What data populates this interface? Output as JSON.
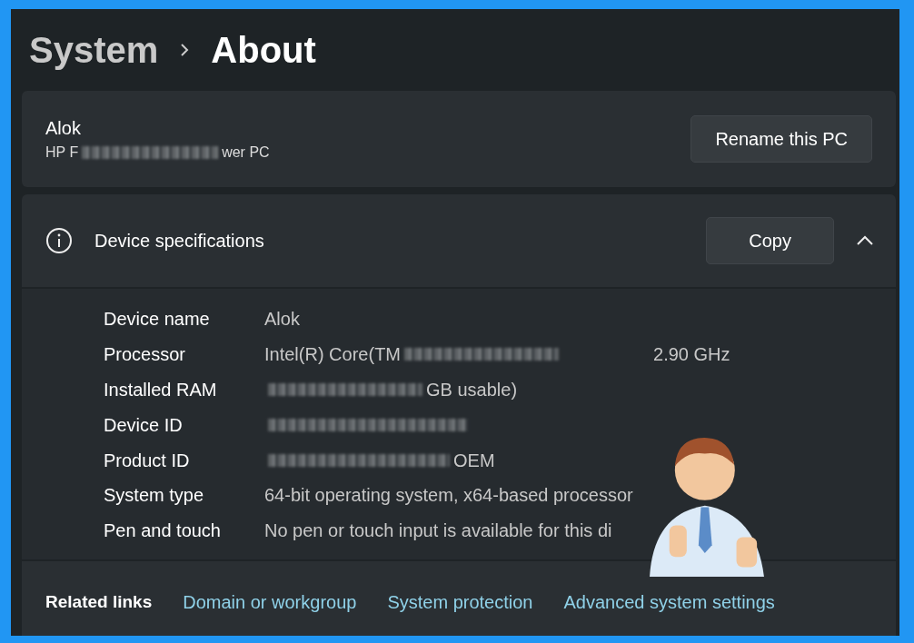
{
  "breadcrumb": [
    {
      "label": "System",
      "current": false
    },
    {
      "label": "About",
      "current": true
    }
  ],
  "pc": {
    "name": "Alok",
    "model": [
      {
        "kind": "text",
        "text": "HP F"
      },
      {
        "kind": "redacted"
      },
      {
        "kind": "text",
        "text": "wer PC"
      }
    ],
    "button": "Rename this PC"
  },
  "specs": {
    "title": "Device specifications",
    "button": "Copy",
    "expanded": true,
    "rows": [
      {
        "label": "Device name",
        "value": [
          {
            "kind": "text",
            "text": "Alok"
          }
        ]
      },
      {
        "label": "Processor",
        "value": [
          {
            "kind": "text",
            "text": "Intel(R) Core(TM"
          },
          {
            "kind": "redacted"
          },
          {
            "kind": "gap"
          },
          {
            "kind": "text",
            "text": "2.90 GHz"
          }
        ]
      },
      {
        "label": "Installed RAM",
        "value": [
          {
            "kind": "redacted"
          },
          {
            "kind": "text",
            "text": "GB usable)"
          }
        ]
      },
      {
        "label": "Device ID",
        "value": [
          {
            "kind": "redacted"
          }
        ]
      },
      {
        "label": "Product ID",
        "value": [
          {
            "kind": "redacted"
          },
          {
            "kind": "text",
            "text": "OEM"
          }
        ]
      },
      {
        "label": "System type",
        "value": [
          {
            "kind": "text",
            "text": "64-bit operating system, x64-based processor"
          }
        ]
      },
      {
        "label": "Pen and touch",
        "value": [
          {
            "kind": "text",
            "text": "No pen or touch input is available for this di"
          }
        ]
      }
    ]
  },
  "related": {
    "label": "Related links",
    "links": [
      "Domain or workgroup",
      "System protection",
      "Advanced system settings"
    ]
  }
}
